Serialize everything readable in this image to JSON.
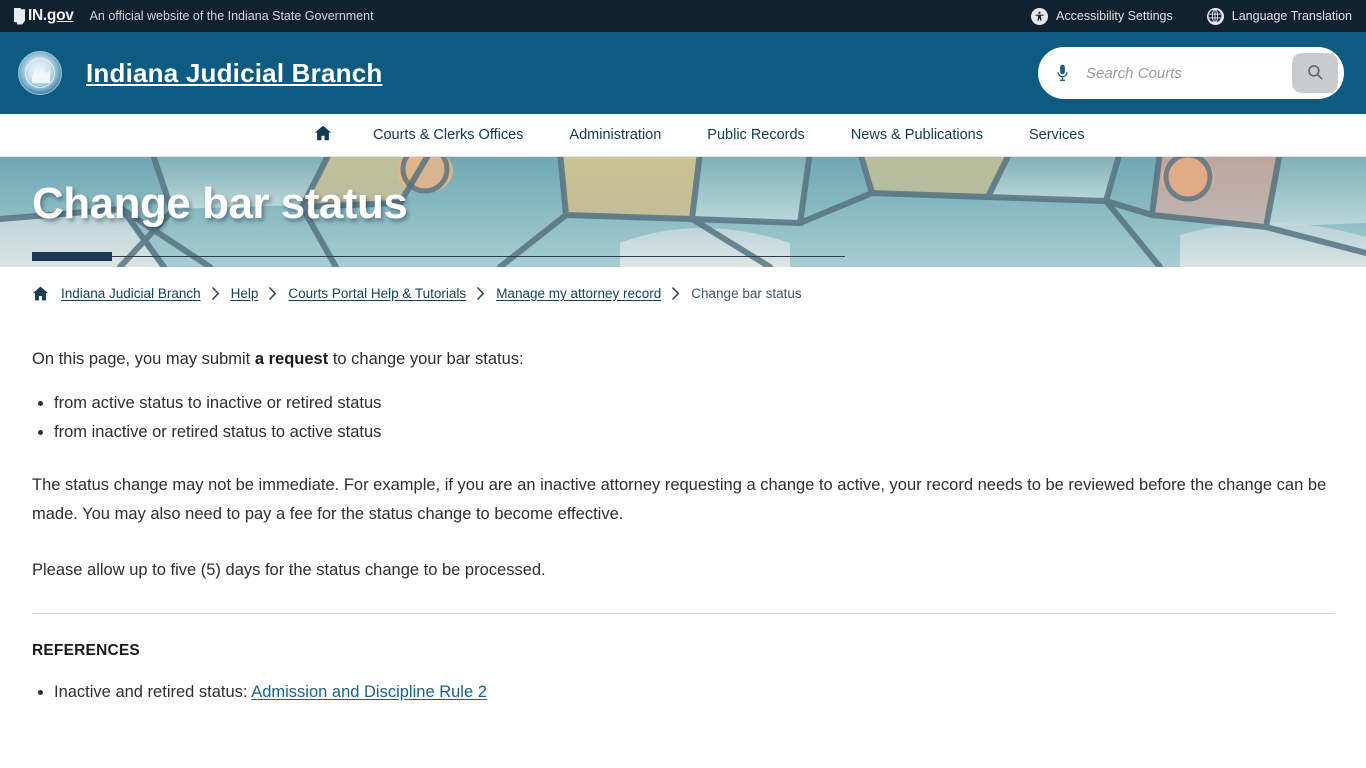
{
  "utility_bar": {
    "logo_text_prefix": "IN.",
    "logo_text_suffix": "gov",
    "tagline": "An official website of the Indiana State Government",
    "links": [
      {
        "label": "Accessibility Settings",
        "icon": "accessibility-icon"
      },
      {
        "label": "Language Translation",
        "icon": "globe-icon"
      }
    ]
  },
  "header": {
    "site_title": "Indiana Judicial Branch",
    "logo_icon": "indiana-judicial-seal-icon",
    "search": {
      "placeholder": "Search Courts",
      "value": "",
      "mic_icon": "microphone-icon",
      "submit_icon": "search-icon"
    }
  },
  "nav": {
    "home_icon": "home-icon",
    "items": [
      {
        "label": "Courts & Clerks Offices"
      },
      {
        "label": "Administration"
      },
      {
        "label": "Public Records"
      },
      {
        "label": "News & Publications"
      },
      {
        "label": "Services"
      }
    ]
  },
  "hero": {
    "title": "Change bar status"
  },
  "breadcrumb": {
    "home_icon": "home-icon",
    "separator": "›",
    "items": [
      {
        "label": "Indiana Judicial Branch",
        "is_link": true
      },
      {
        "label": "Help",
        "is_link": true
      },
      {
        "label": "Courts Portal Help & Tutorials",
        "is_link": true
      },
      {
        "label": "Manage my attorney record",
        "is_link": true
      },
      {
        "label": "Change bar status",
        "is_link": false
      }
    ]
  },
  "main": {
    "intro_before": "On this page, you may submit ",
    "intro_bold": "a request",
    "intro_after": " to change your bar status:",
    "bullets": [
      "from active status to inactive or retired status",
      "from inactive or retired status to active status"
    ],
    "paragraph_2": "The status change may not be immediate. For example, if you are an inactive attorney requesting a change to active, your record needs to be reviewed before the change can be made. You may also need to pay a fee for the status change to become effective.",
    "paragraph_3": "Please allow up to five (5) days for the status change to be processed.",
    "references_heading": "REFERENCES",
    "references": [
      {
        "prefix": "Inactive and retired status: ",
        "link_label": "Admission and Discipline Rule 2"
      }
    ]
  },
  "colors": {
    "utility_bar_bg": "#122130",
    "header_bg": "#0d5b81",
    "nav_text": "#123a52",
    "hero_accent": "#1b3a55",
    "link": "#1b6183",
    "breadcrumb_link": "#14435f"
  }
}
